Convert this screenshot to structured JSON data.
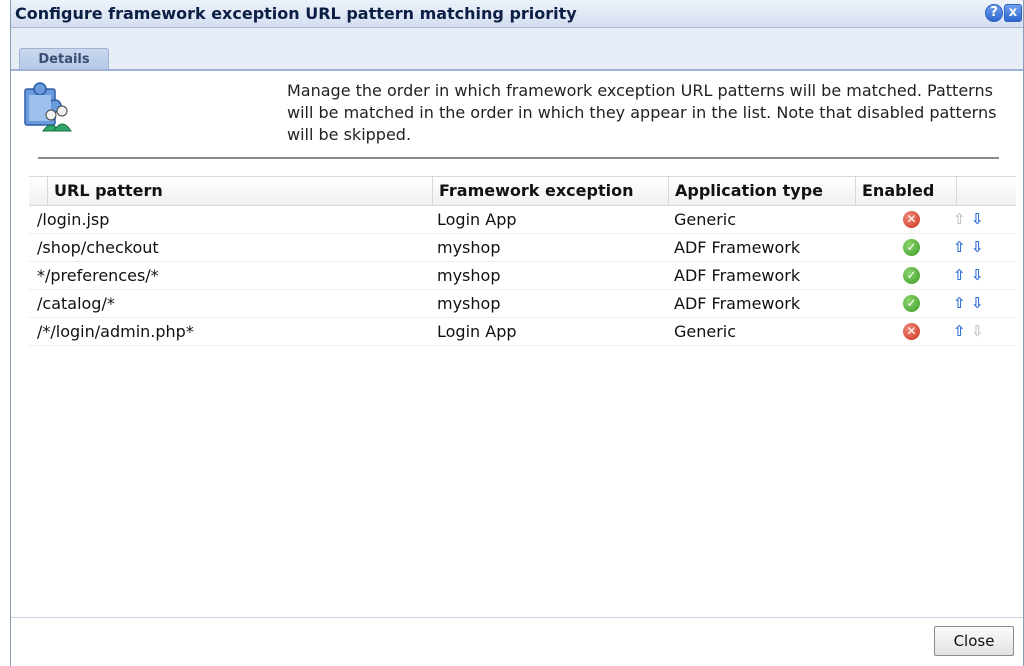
{
  "dialog": {
    "title": "Configure framework exception URL pattern matching priority",
    "help_label": "?",
    "close_x_label": "x"
  },
  "tabs": [
    {
      "label": "Details",
      "active": true
    }
  ],
  "description": "Manage the order in which framework exception URL patterns will be matched. Patterns will be matched in the order in which they appear in the list. Note that disabled patterns will be skipped.",
  "table": {
    "columns": [
      "URL pattern",
      "Framework exception",
      "Application type",
      "Enabled"
    ],
    "rows": [
      {
        "url": "/login.jsp",
        "framework": "Login App",
        "app_type": "Generic",
        "enabled": false,
        "can_move_up": false,
        "can_move_down": true
      },
      {
        "url": "/shop/checkout",
        "framework": "myshop",
        "app_type": "ADF Framework",
        "enabled": true,
        "can_move_up": true,
        "can_move_down": true
      },
      {
        "url": "*/preferences/*",
        "framework": "myshop",
        "app_type": "ADF Framework",
        "enabled": true,
        "can_move_up": true,
        "can_move_down": true
      },
      {
        "url": "/catalog/*",
        "framework": "myshop",
        "app_type": "ADF Framework",
        "enabled": true,
        "can_move_up": true,
        "can_move_down": true
      },
      {
        "url": "/*/login/admin.php*",
        "framework": "Login App",
        "app_type": "Generic",
        "enabled": false,
        "can_move_up": true,
        "can_move_down": false
      }
    ]
  },
  "footer": {
    "close_label": "Close"
  },
  "icons": {
    "enabled": "check-circle-icon",
    "disabled": "x-circle-icon",
    "move_up": "arrow-up-icon",
    "move_down": "arrow-down-icon",
    "header": "puzzle-users-icon"
  },
  "colors": {
    "enabled": "#3c9a25",
    "disabled": "#c8321c",
    "arrow_active": "#2f6fd6",
    "arrow_inactive": "#c5c5c5"
  }
}
